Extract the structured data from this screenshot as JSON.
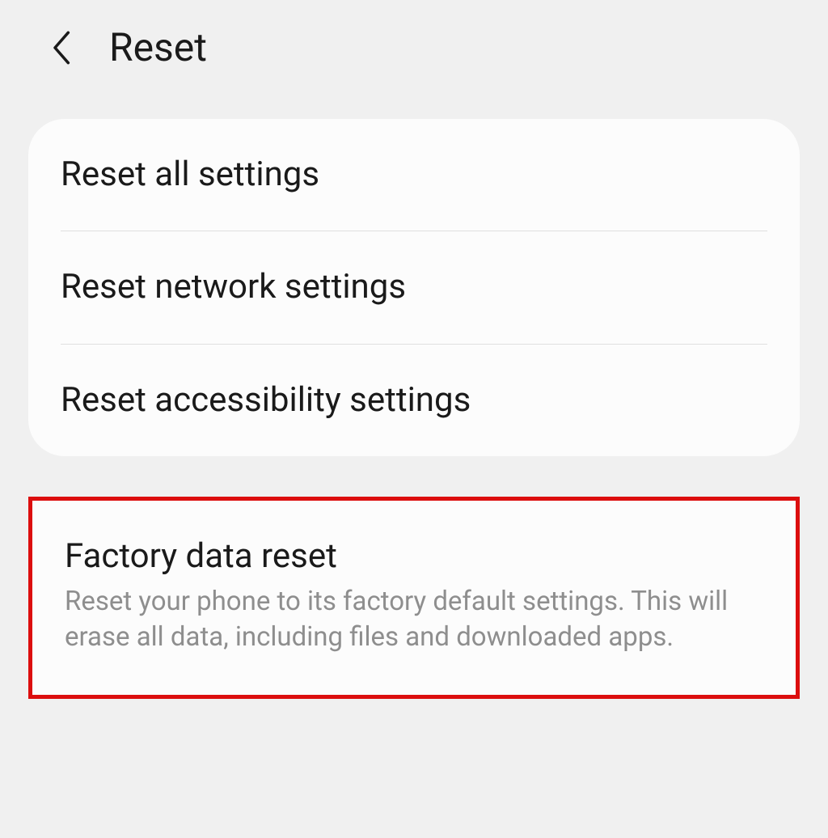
{
  "header": {
    "title": "Reset"
  },
  "section1": {
    "items": [
      {
        "title": "Reset all settings"
      },
      {
        "title": "Reset network settings"
      },
      {
        "title": "Reset accessibility settings"
      }
    ]
  },
  "section2": {
    "item": {
      "title": "Factory data reset",
      "description": "Reset your phone to its factory default settings. This will erase all data, including files and downloaded apps."
    }
  }
}
